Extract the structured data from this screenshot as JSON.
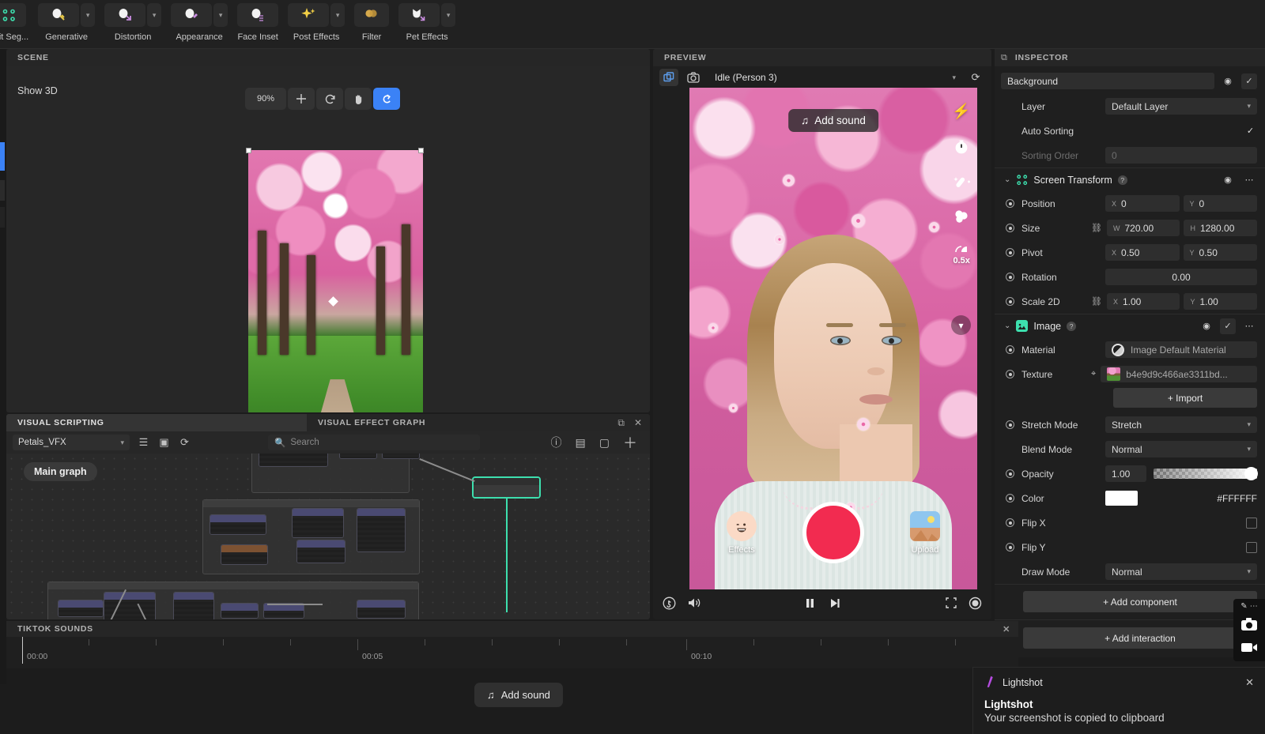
{
  "toolbar": {
    "items": [
      {
        "label": "trait Seg...",
        "icon": "portrait-segmentation-icon",
        "glyph": "⠿",
        "caret": false
      },
      {
        "label": "Generative",
        "icon": "generative-icon",
        "glyph": "✋",
        "caret": true
      },
      {
        "label": "Distortion",
        "icon": "distortion-icon",
        "glyph": "✋",
        "caret": true
      },
      {
        "label": "Appearance",
        "icon": "appearance-icon",
        "glyph": "✋",
        "caret": true
      },
      {
        "label": "Face Inset",
        "icon": "face-inset-icon",
        "glyph": "✋",
        "caret": false
      },
      {
        "label": "Post Effects",
        "icon": "post-effects-icon",
        "glyph": "✦",
        "caret": true
      },
      {
        "label": "Filter",
        "icon": "filter-icon",
        "glyph": "◕",
        "caret": false
      },
      {
        "label": "Pet Effects",
        "icon": "pet-effects-icon",
        "glyph": "🐱",
        "caret": true
      }
    ]
  },
  "scene": {
    "panel_title": "SCENE",
    "show_3d_label": "Show 3D",
    "zoom_level": "90%",
    "tools": [
      {
        "name": "zoom-level",
        "glyph": "90%"
      },
      {
        "name": "move-tool",
        "glyph": "✛"
      },
      {
        "name": "rotate-tool",
        "glyph": "↻"
      },
      {
        "name": "pan-tool",
        "glyph": "✋"
      },
      {
        "name": "orbit-tool",
        "glyph": "⟳",
        "active": true
      }
    ]
  },
  "visual_scripting": {
    "tab_label": "VISUAL SCRIPTING",
    "graph_tab_label": "VISUAL EFFECT GRAPH",
    "selected_vfx": "Petals_VFX",
    "search_placeholder": "Search",
    "main_graph_label": "Main graph",
    "toolbar_icons": [
      "list-icon",
      "frame-icon",
      "refresh-icon"
    ],
    "right_icons": [
      "info-icon",
      "blackboard-icon",
      "minimap-icon",
      "add-icon"
    ],
    "tab_icons": [
      "popout-icon",
      "close-icon"
    ]
  },
  "preview": {
    "panel_title": "PREVIEW",
    "state_label": "Idle (Person 3)",
    "icons": [
      "duplicate-icon",
      "camera-icon"
    ],
    "phone_ui": {
      "add_sound_label": "Add sound",
      "rail": [
        {
          "name": "flash-icon",
          "glyph": "⚡",
          "label": ""
        },
        {
          "name": "timer-icon",
          "glyph": "⏱",
          "label": ""
        },
        {
          "name": "beautify-icon",
          "glyph": "🪄",
          "label": ""
        },
        {
          "name": "filters-icon",
          "glyph": "◓",
          "label": ""
        },
        {
          "name": "speed-icon",
          "glyph": "◔",
          "label": "0.5x"
        }
      ],
      "effects_label": "Effects",
      "upload_label": "Upload",
      "record_button": "record-button"
    },
    "playbar": {
      "left_icons": [
        "tiktok-icon",
        "volume-icon"
      ],
      "center_icons": [
        "pause-icon",
        "step-forward-icon"
      ],
      "right_icons": [
        "crop-icon",
        "record-dot-icon"
      ]
    }
  },
  "inspector": {
    "panel_title": "INSPECTOR",
    "object_name": "Background",
    "properties": [
      {
        "label": "Layer",
        "type": "select",
        "value": "Default Layer"
      },
      {
        "label": "Auto Sorting",
        "type": "check",
        "value": "✓"
      },
      {
        "label": "Sorting Order",
        "type": "text",
        "value": "0",
        "dim": true
      }
    ],
    "screen_transform": {
      "title": "Screen Transform",
      "rows": [
        {
          "label": "Position",
          "x_axis": "X",
          "x": "0",
          "y_axis": "Y",
          "y": "0",
          "link": false
        },
        {
          "label": "Size",
          "x_axis": "W",
          "x": "720.00",
          "y_axis": "H",
          "y": "1280.00",
          "link": true
        },
        {
          "label": "Pivot",
          "x_axis": "X",
          "x": "0.50",
          "y_axis": "Y",
          "y": "0.50",
          "link": false
        }
      ],
      "rotation_label": "Rotation",
      "rotation_value": "0.00",
      "scale_label": "Scale 2D",
      "scale_x_axis": "X",
      "scale_x": "1.00",
      "scale_y_axis": "Y",
      "scale_y": "1.00"
    },
    "image_section": {
      "title": "Image",
      "material_label": "Material",
      "material_value": "Image Default Material",
      "texture_label": "Texture",
      "texture_value": "b4e9d9c466ae3311bd...",
      "import_label": "+ Import",
      "stretch_mode_label": "Stretch Mode",
      "stretch_mode_value": "Stretch",
      "blend_mode_label": "Blend Mode",
      "blend_mode_value": "Normal",
      "opacity_label": "Opacity",
      "opacity_value": "1.00",
      "color_label": "Color",
      "color_hex": "#FFFFFF",
      "flip_x_label": "Flip X",
      "flip_y_label": "Flip Y",
      "draw_mode_label": "Draw Mode",
      "draw_mode_value": "Normal"
    },
    "add_component_label": "+ Add component",
    "add_interaction_label": "+ Add interaction"
  },
  "capture_widget": {
    "icons": [
      "pen-icon",
      "more-icon",
      "screenshot-camera-icon",
      "record-video-icon"
    ]
  },
  "timeline": {
    "title": "TIKTOK SOUNDS",
    "labels": [
      "00:00",
      "00:05",
      "00:10"
    ],
    "add_sound_label": "Add sound"
  },
  "toast": {
    "app_name": "Lightshot",
    "title": "Lightshot",
    "message": "Your screenshot is copied to clipboard",
    "close": "✕"
  },
  "colors": {
    "accent_blue": "#3b82f6",
    "record_red": "#f22b50",
    "graph_green": "#3ddfae",
    "toast_purple": "#b54ce0"
  }
}
